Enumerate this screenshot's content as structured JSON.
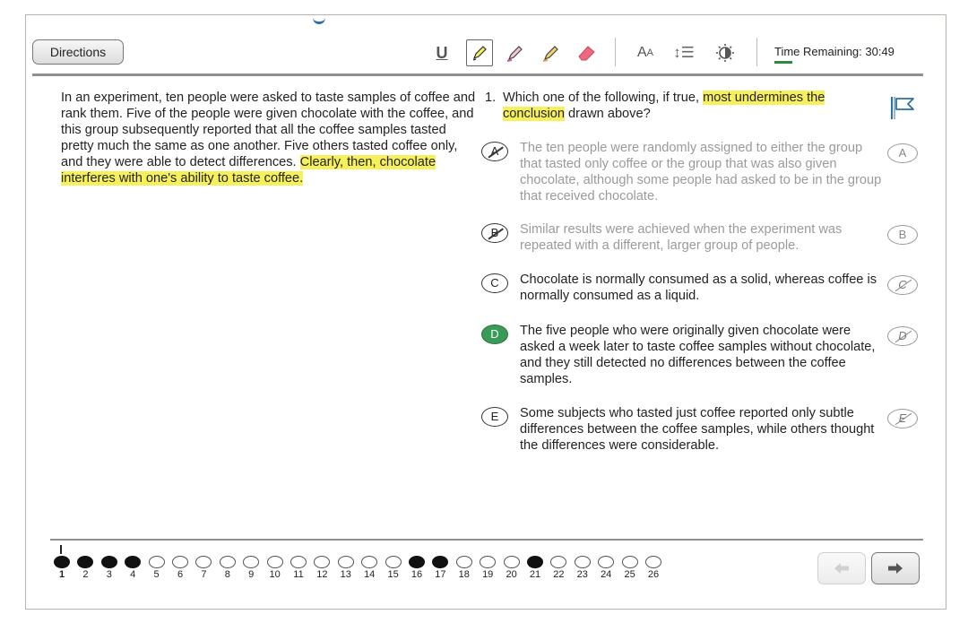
{
  "toolbar": {
    "directions_label": "Directions",
    "underline_label": "U",
    "font_size_label": "A",
    "font_size_small_label": "A",
    "line_spacing_label": "↕☰",
    "time_label": "Time Remaining: 30:49"
  },
  "passage": {
    "text_plain": "In an experiment, ten people were asked to taste samples of coffee and rank them. Five of the people were given chocolate with the coffee, and this group subsequently reported that all the coffee samples tasted pretty much the same as one another. Five others tasted coffee only, and they were able to detect differences. ",
    "text_highlight": "Clearly, then, chocolate interferes with one's ability to taste coffee."
  },
  "question": {
    "number": "1.",
    "text_before": "Which one of the following, if true, ",
    "text_highlight": "most undermines the conclusion",
    "text_after": " drawn above?"
  },
  "choices": [
    {
      "letter": "A",
      "text": "The ten people were randomly assigned to either the group that tasted only coffee or the group that was also given chocolate, although some people had asked to be in the group that received chocolate.",
      "state": "eliminated"
    },
    {
      "letter": "B",
      "text": "Similar results were achieved when the experiment was repeated with a different, larger group of people.",
      "state": "eliminated"
    },
    {
      "letter": "C",
      "text": "Chocolate is normally consumed as a solid, whereas coffee is normally consumed as a liquid.",
      "state": "normal"
    },
    {
      "letter": "D",
      "text": "The five people who were originally given chocolate were asked a week later to taste coffee samples without chocolate, and they still detected no differences between the coffee samples.",
      "state": "selected"
    },
    {
      "letter": "E",
      "text": "Some subjects who tasted just coffee reported only subtle differences between the coffee samples, while others thought the differences were considerable.",
      "state": "normal"
    }
  ],
  "progress": {
    "current": 1,
    "items": [
      {
        "n": "1",
        "answered": true
      },
      {
        "n": "2",
        "answered": true
      },
      {
        "n": "3",
        "answered": true
      },
      {
        "n": "4",
        "answered": true
      },
      {
        "n": "5",
        "answered": false
      },
      {
        "n": "6",
        "answered": false
      },
      {
        "n": "7",
        "answered": false
      },
      {
        "n": "8",
        "answered": false
      },
      {
        "n": "9",
        "answered": false
      },
      {
        "n": "10",
        "answered": false
      },
      {
        "n": "11",
        "answered": false
      },
      {
        "n": "12",
        "answered": false
      },
      {
        "n": "13",
        "answered": false
      },
      {
        "n": "14",
        "answered": false
      },
      {
        "n": "15",
        "answered": false
      },
      {
        "n": "16",
        "answered": true
      },
      {
        "n": "17",
        "answered": true
      },
      {
        "n": "18",
        "answered": false
      },
      {
        "n": "19",
        "answered": false
      },
      {
        "n": "20",
        "answered": false
      },
      {
        "n": "21",
        "answered": true
      },
      {
        "n": "22",
        "answered": false
      },
      {
        "n": "23",
        "answered": false
      },
      {
        "n": "24",
        "answered": false
      },
      {
        "n": "25",
        "answered": false
      },
      {
        "n": "26",
        "answered": false
      }
    ]
  },
  "colors": {
    "highlight": "#f6f05a",
    "selected_answer": "#3a9b58",
    "timer_bar": "#2e8b3d",
    "flag": "#2d6fa8"
  },
  "icons": {
    "underline": "underline-icon",
    "highlighter_active": "pencil-highlight-icon",
    "highlighter_pink": "pink-highlighter-icon",
    "highlighter_orange": "orange-highlighter-icon",
    "eraser": "eraser-icon",
    "font_size": "font-size-icon",
    "line_spacing": "line-spacing-icon",
    "contrast": "contrast-icon",
    "flag": "flag-icon",
    "prev": "arrow-left-icon",
    "next": "arrow-right-icon"
  }
}
